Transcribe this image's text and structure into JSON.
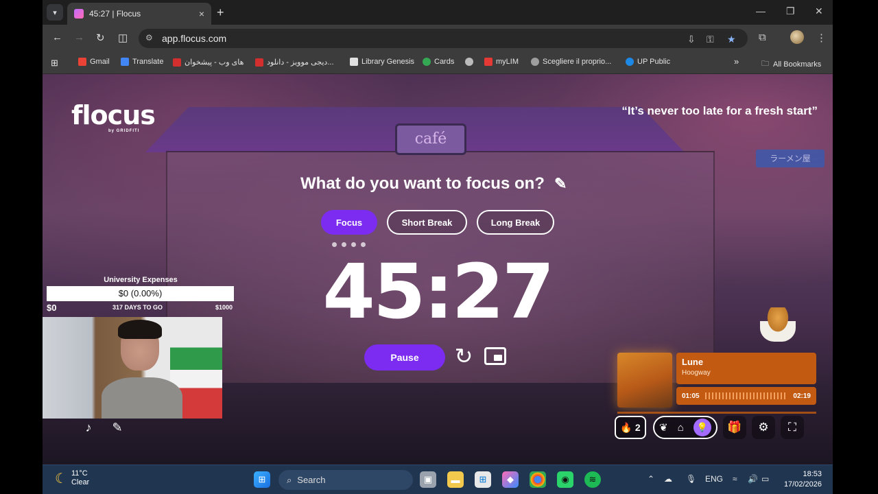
{
  "browser": {
    "tab_title": "45:27 | Flocus",
    "new_tab": "+",
    "close_tab": "×",
    "url": "app.flocus.com",
    "window_controls": {
      "minimize": "—",
      "restore": "❐",
      "close": "✕"
    },
    "bookmarks": [
      {
        "label": "Gmail",
        "color": "#ea4335"
      },
      {
        "label": "Translate",
        "color": "#4285f4"
      },
      {
        "label": "های وب - پیشخوان",
        "color": "#d32f2f"
      },
      {
        "label": "دیجی موویز - دانلود...",
        "color": "#d32f2f"
      },
      {
        "label": "Library Genesis",
        "color": "#e0e0e0"
      },
      {
        "label": "Cards",
        "color": "#34a853"
      },
      {
        "label": "",
        "color": "#bbbbbb"
      },
      {
        "label": "myLIM",
        "color": "#e53935"
      },
      {
        "label": "Scegliere il proprio...",
        "color": "#9e9e9e"
      },
      {
        "label": "UP Public",
        "color": "#1e88e5"
      }
    ],
    "all_bookmarks": "All Bookmarks",
    "more_bookmarks": "»"
  },
  "app": {
    "logo": "flocus",
    "logo_sub": "by GRIDFITI",
    "quote": "“It’s never too late for a fresh start”",
    "cafe_sign": "café",
    "lantern_sign": "ラーメン屋",
    "focus_prompt": "What do you want to focus on?",
    "modes": [
      "Focus",
      "Short Break",
      "Long Break"
    ],
    "active_mode": "Focus",
    "session_dots": 4,
    "timer": "45:27",
    "pause_label": "Pause",
    "goal": {
      "title": "University Expenses",
      "amount": "$0 (0.00%)",
      "min": "$0",
      "days_left": "317 DAYS TO GO",
      "max": "$1000",
      "progress": 0
    },
    "music": {
      "title": "Lune",
      "artist": "Hoogway",
      "elapsed": "01:05",
      "duration": "02:19"
    },
    "streak": "2",
    "accent_color": "#7b2cf0",
    "music_color": "#c25a12"
  },
  "taskbar": {
    "temperature": "11°C",
    "condition": "Clear",
    "search_placeholder": "Search",
    "language": "ENG",
    "time": "18:53",
    "date": "17/02/2026"
  }
}
